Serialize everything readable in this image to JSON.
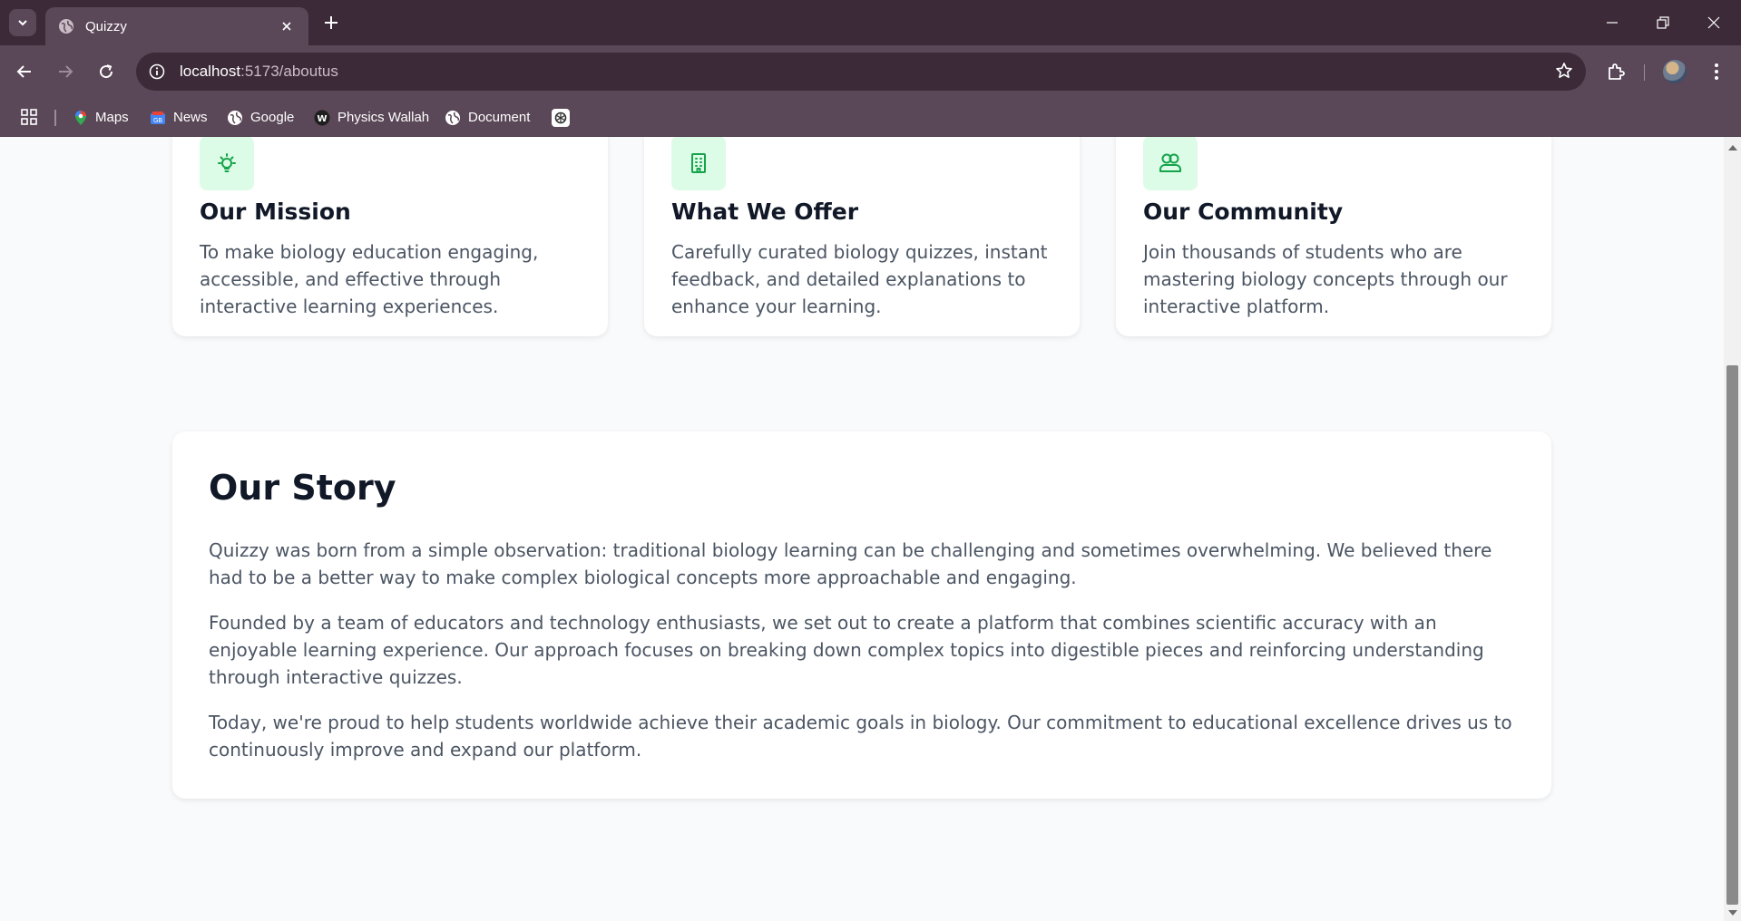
{
  "browser": {
    "tab_title": "Quizzy",
    "url_host": "localhost",
    "url_path": ":5173/aboutus",
    "bookmarks": [
      {
        "label": "Maps"
      },
      {
        "label": "News"
      },
      {
        "label": "Google"
      },
      {
        "label": "Physics Wallah"
      },
      {
        "label": "Document"
      }
    ]
  },
  "cards": [
    {
      "icon": "lightbulb-icon",
      "title": "Our Mission",
      "text": "To make biology education engaging, accessible, and effective through interactive learning experiences."
    },
    {
      "icon": "building-icon",
      "title": "What We Offer",
      "text": "Carefully curated biology quizzes, instant feedback, and detailed explanations to enhance your learning."
    },
    {
      "icon": "users-icon",
      "title": "Our Community",
      "text": "Join thousands of students who are mastering biology concepts through our interactive platform."
    }
  ],
  "story": {
    "title": "Our Story",
    "paragraphs": [
      "Quizzy was born from a simple observation: traditional biology learning can be challenging and sometimes overwhelming. We believed there had to be a better way to make complex biological concepts more approachable and engaging.",
      "Founded by a team of educators and technology enthusiasts, we set out to create a platform that combines scientific accuracy with an enjoyable learning experience. Our approach focuses on breaking down complex topics into digestible pieces and reinforcing understanding through interactive quizzes.",
      "Today, we're proud to help students worldwide achieve their academic goals in biology. Our commitment to educational excellence drives us to continuously improve and expand our platform."
    ]
  },
  "colors": {
    "accent_green": "#16a34a",
    "icon_bg": "#dcfce7",
    "chrome_dark": "#3c2a38",
    "chrome_mid": "#5a4757"
  }
}
